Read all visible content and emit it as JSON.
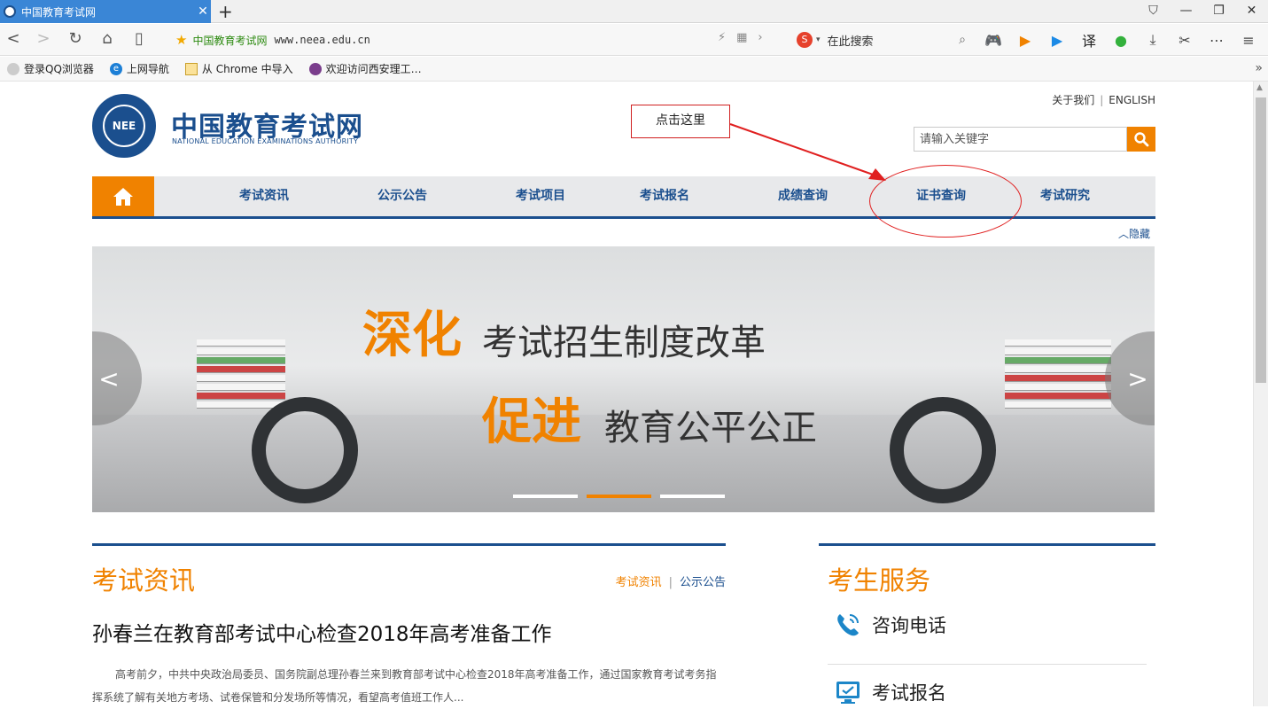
{
  "browser": {
    "tab_title": "中国教育考试网",
    "site_name": "中国教育考试网",
    "url": "www.neea.edu.cn",
    "search_placeholder": "在此搜索",
    "bookmarks": [
      "登录QQ浏览器",
      "上网导航",
      "从 Chrome 中导入",
      "欢迎访问西安理工…"
    ]
  },
  "header": {
    "logo_cn": "中国教育考试网",
    "logo_en": "NATIONAL EDUCATION EXAMINATIONS AUTHORITY",
    "logo_mark": "NEE",
    "about": "关于我们",
    "english": "ENGLISH",
    "search_placeholder": "请输入关键字"
  },
  "annotation": {
    "callout_text": "点击这里"
  },
  "nav": {
    "items": [
      "考试资讯",
      "公示公告",
      "考试项目",
      "考试报名",
      "成绩查询",
      "证书查询",
      "考试研究"
    ],
    "hide_label": "隐藏"
  },
  "banner": {
    "line1_em": "深化",
    "line1_text": "考试招生制度改革",
    "line2_em": "促进",
    "line2_text": "教育公平公正",
    "active_slide": 2,
    "slide_count": 3
  },
  "news": {
    "title": "考试资讯",
    "link_active": "考试资讯",
    "link_other": "公示公告",
    "headline": "孙春兰在教育部考试中心检查2018年高考准备工作",
    "summary": "高考前夕，中共中央政治局委员、国务院副总理孙春兰来到教育部考试中心检查2018年高考准备工作，通过国家教育考试考务指挥系统了解有关地方考场、试卷保管和分发场所等情况，看望高考值班工作人..."
  },
  "services": {
    "title": "考生服务",
    "items": [
      "咨询电话",
      "考试报名"
    ]
  },
  "colors": {
    "brand_blue": "#1b4f8e",
    "accent_orange": "#f08200",
    "annotation_red": "#e02020"
  }
}
